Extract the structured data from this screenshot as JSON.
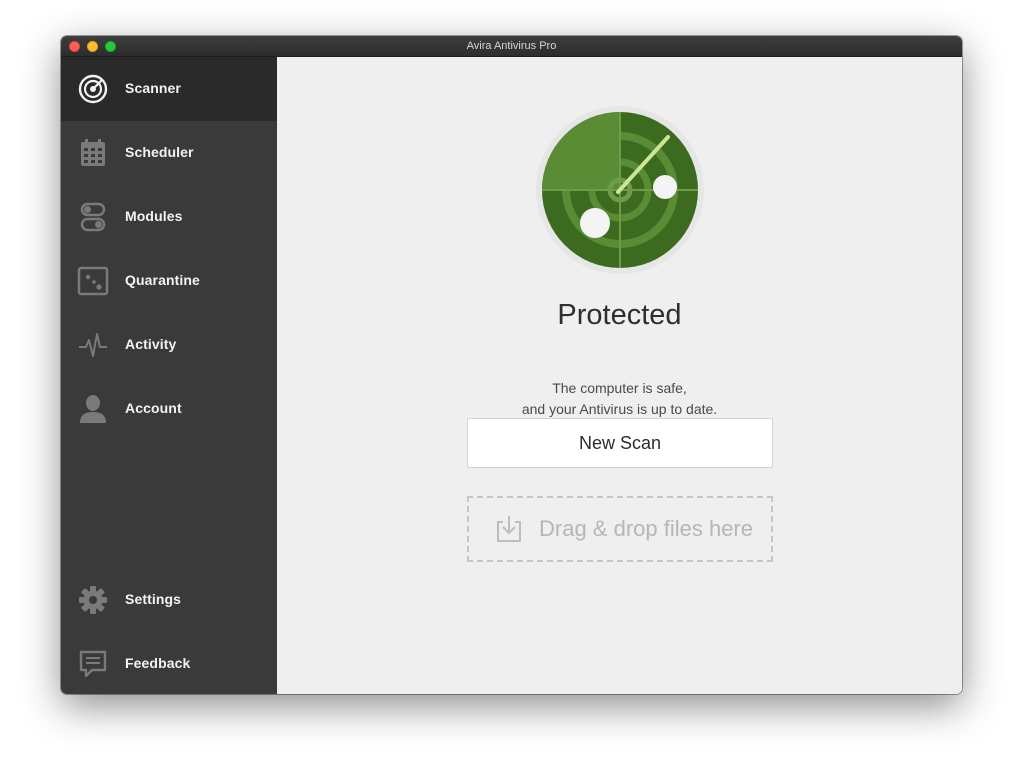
{
  "window": {
    "title": "Avira Antivirus Pro"
  },
  "sidebar": {
    "items": [
      {
        "label": "Scanner",
        "icon": "radar-icon",
        "active": true
      },
      {
        "label": "Scheduler",
        "icon": "calendar-icon",
        "active": false
      },
      {
        "label": "Modules",
        "icon": "toggle-icon",
        "active": false
      },
      {
        "label": "Quarantine",
        "icon": "quarantine-box-icon",
        "active": false
      },
      {
        "label": "Activity",
        "icon": "pulse-icon",
        "active": false
      },
      {
        "label": "Account",
        "icon": "user-icon",
        "active": false
      }
    ],
    "bottom_items": [
      {
        "label": "Settings",
        "icon": "gear-icon"
      },
      {
        "label": "Feedback",
        "icon": "chat-bubble-icon"
      }
    ]
  },
  "main": {
    "status_icon": "radar-icon",
    "status_title": "Protected",
    "status_line1": "The computer is safe,",
    "status_line2": "and your Antivirus is up to date.",
    "new_scan_label": "New Scan",
    "dropzone_label": "Drag & drop files here",
    "dropzone_icon": "download-tray-icon"
  },
  "colors": {
    "sidebar_bg": "#3a3a3a",
    "sidebar_active_bg": "#2a2a2a",
    "radar_green": "#3c6b1f",
    "radar_light_green": "#5a8c35",
    "radar_beam": "#c9e59a"
  }
}
